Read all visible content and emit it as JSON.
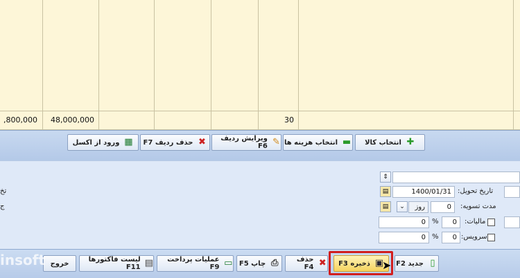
{
  "grid": {
    "totals_row": [
      {
        "value": ",800,000"
      },
      {
        "value": "48,000,000"
      },
      {
        "value": ""
      },
      {
        "value": ""
      },
      {
        "value": ""
      },
      {
        "value": "30"
      },
      {
        "value": ""
      }
    ]
  },
  "row_toolbar": {
    "import_excel": "ورود از اکسل",
    "delete_row": "حذف ردیف F7",
    "edit_row": "ویرایش ردیف F6",
    "select_cost": "انتخاب هزینه ها",
    "select_goods": "انتخاب کالا"
  },
  "form": {
    "delivery_date_label": "تاریخ تحویل:",
    "delivery_date_value": "1400/01/31",
    "settlement_label": "مدت تسویه:",
    "settlement_value": "0",
    "settlement_unit": "روز",
    "tax_label": "مالیات:",
    "tax_percent": "0",
    "tax_amount": "0",
    "service_label": "سرویس:",
    "service_percent": "0",
    "service_amount": "0",
    "percent_sign": "%",
    "left_label_1": "تخ",
    "left_label_2": "ج"
  },
  "bottom_toolbar": {
    "new": "جدید F2",
    "save": "ذخیره F3",
    "delete": "حذف F4",
    "print": "چاپ F5",
    "payment_ops": "عملیات پرداخت F9",
    "invoice_list": "لیست فاکتورها F11",
    "exit": "خروج"
  },
  "watermark": "insoft",
  "colors": {
    "grid_bg": "#fdf6d8",
    "highlight": "#d21e1e",
    "toolbar": "#b4c9e8"
  }
}
